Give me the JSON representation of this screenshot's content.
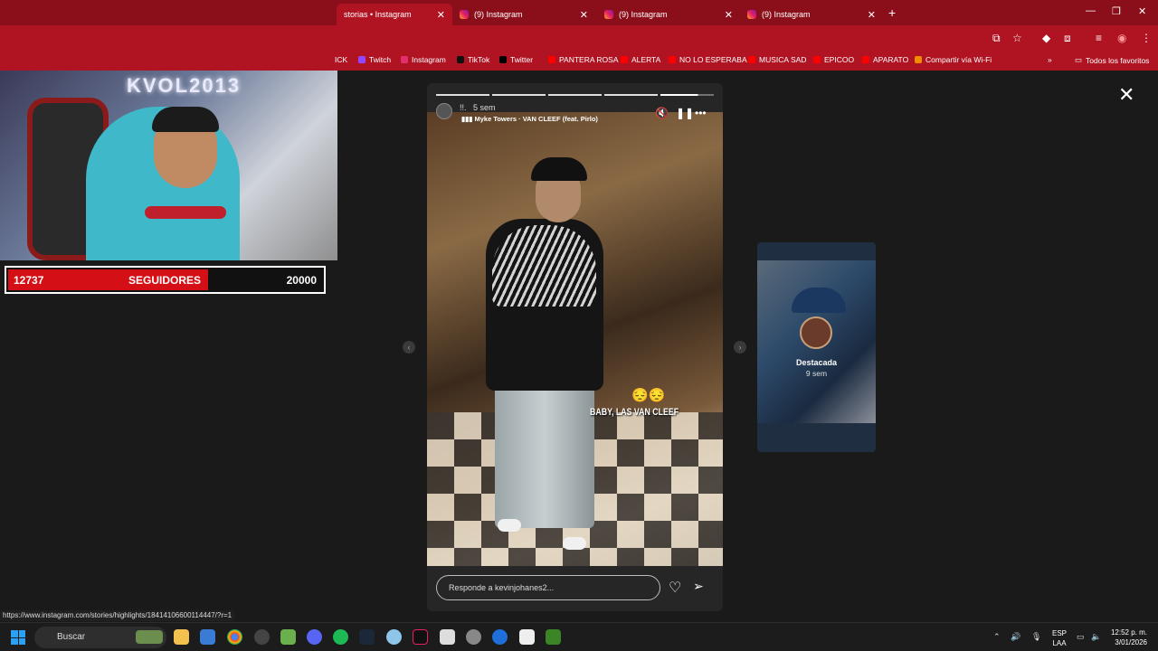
{
  "browser": {
    "tabs": [
      {
        "title": "storias • Instagram",
        "active": true
      },
      {
        "title": "(9) Instagram",
        "active": false
      },
      {
        "title": "(9) Instagram",
        "active": false
      },
      {
        "title": "(9) Instagram",
        "active": false
      }
    ],
    "new_tab": "+",
    "bookmarks": [
      {
        "label": "ICK",
        "icon": "generic-icon"
      },
      {
        "label": "Twitch",
        "icon": "twitch-icon"
      },
      {
        "label": "Instagram",
        "icon": "instagram-icon"
      },
      {
        "label": "TikTok",
        "icon": "tiktok-icon"
      },
      {
        "label": "Twitter",
        "icon": "x-icon"
      },
      {
        "label": "PANTERA ROSA",
        "icon": "youtube-icon"
      },
      {
        "label": "ALERTA",
        "icon": "youtube-icon"
      },
      {
        "label": "NO LO ESPERABA",
        "icon": "youtube-icon"
      },
      {
        "label": "MUSICA SAD",
        "icon": "youtube-icon"
      },
      {
        "label": "EPICOO",
        "icon": "youtube-icon"
      },
      {
        "label": "APARATO",
        "icon": "youtube-icon"
      },
      {
        "label": "Compartir vía Wi-Fi",
        "icon": "vlc-icon"
      }
    ],
    "more_bookmarks": "»",
    "all_bookmarks": "Todos los favoritos",
    "status_url": "https://www.instagram.com/stories/highlights/18414106600114447/?r=1",
    "accent_color": "#b01322"
  },
  "overlay": {
    "followers_current": "12737",
    "followers_label": "SEGUIDORES",
    "followers_goal": "20000",
    "progress_fraction": 0.637,
    "cam_logo": "KVOL2013"
  },
  "story": {
    "time_ago": "5 sem",
    "username_prefix": "!!.",
    "song": "Myke Towers · VAN CLEEF (feat. Pirlo)",
    "caption": "BABY, LAS VAN CLEEF",
    "emoji": "😔😔",
    "reply_placeholder": "Responde a kevinjohanes2...",
    "segments": 5,
    "current_segment": 5,
    "current_segment_progress": 0.7
  },
  "next_highlight": {
    "title": "Destacada",
    "time_ago": "9 sem"
  },
  "taskbar": {
    "search_placeholder": "Buscar",
    "language_line1": "ESP",
    "language_line2": "LAA",
    "time": "12:52 p. m.",
    "date": "3/01/2026"
  }
}
